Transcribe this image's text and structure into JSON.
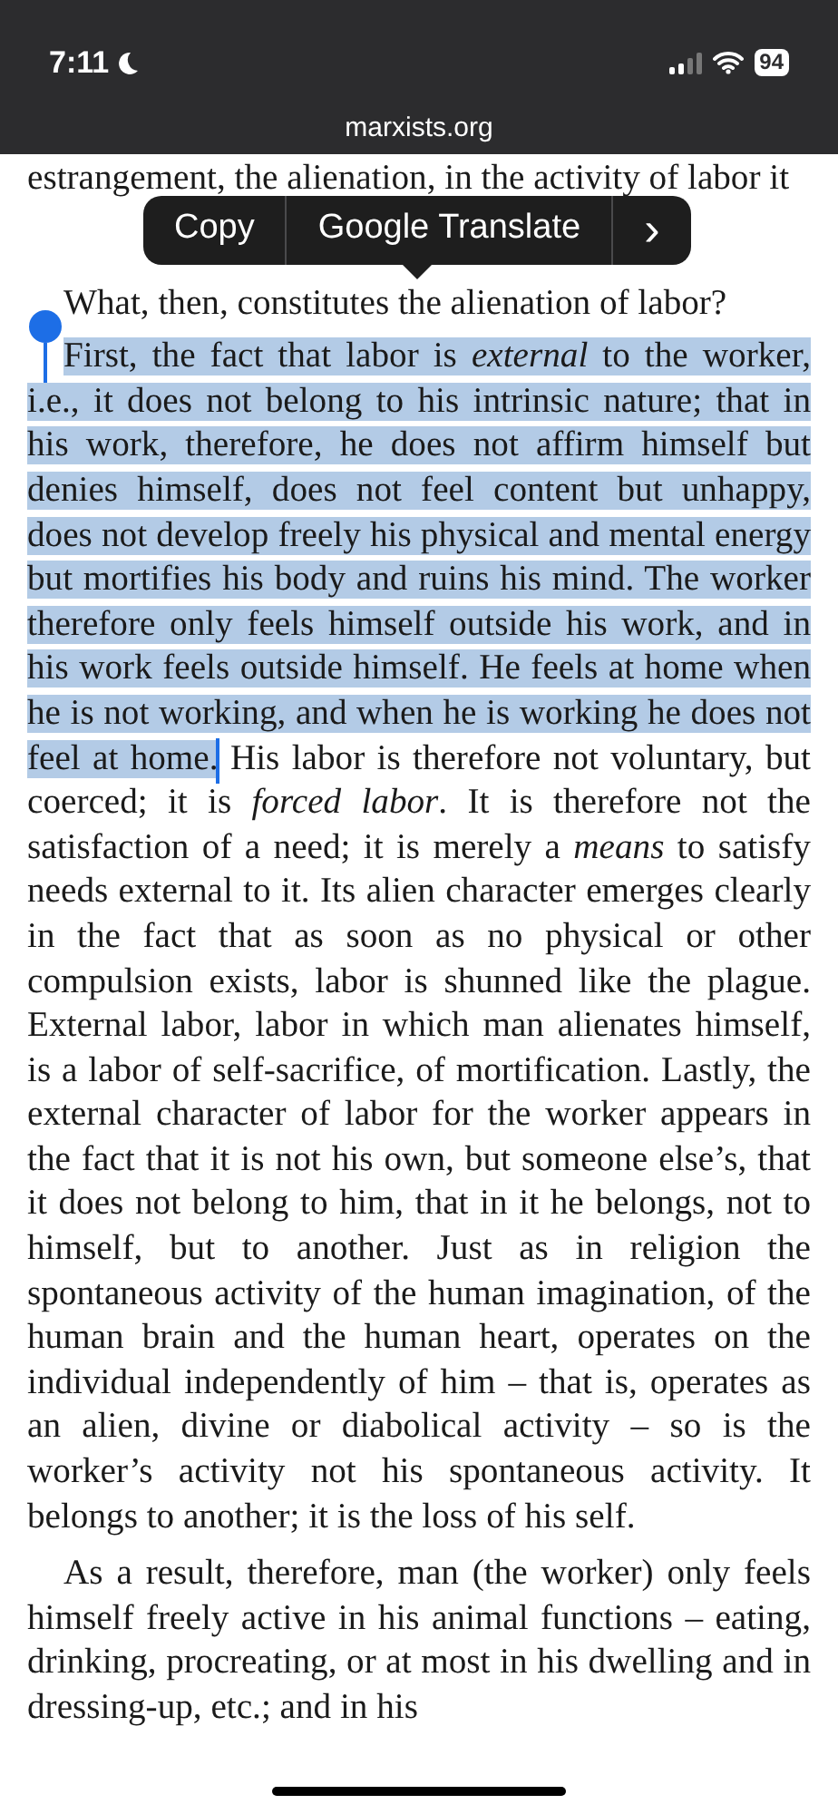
{
  "status_bar": {
    "time": "7:11",
    "battery": "94"
  },
  "address_bar": {
    "url": "marxists.org"
  },
  "edit_menu": {
    "items": [
      {
        "kind": "action",
        "label": "Copy"
      },
      {
        "kind": "action",
        "label": "Google Translate"
      },
      {
        "kind": "more",
        "label": "›"
      }
    ]
  },
  "paragraphs": [
    {
      "indent": false,
      "segments": [
        {
          "text": "estrangement, the alienation, in the activity of labor it",
          "selected": false
        }
      ]
    },
    {
      "indent": true,
      "segments": [
        {
          "text": "What, then, constitutes the alienation of labor?",
          "selected": false
        }
      ]
    },
    {
      "indent": true,
      "segments": [
        {
          "text": "First, the fact that labor is *external* to the worker, i.e., it does not belong to his intrinsic nature; that in his work, therefore, he does not affirm himself but denies himself, does not feel content but unhappy, does not develop freely his physical and mental energy but mortifies his body and ruins his mind. The worker therefore only feels himself outside his work, and in his work feels outside himself. He feels at home when he is not working, and when he is working he does not feel at home.",
          "selected": true
        },
        {
          "text": " His labor is therefore not voluntary, but coerced; it is *forced labor*. It is therefore not the satisfaction of a need; it is merely a *means* to satisfy needs external to it. Its alien character emerges clearly in the fact that as soon as no physical or other compulsion exists, labor is shunned like the plague. External labor, labor in which man alienates himself, is a labor of self-sacrifice, of mortification. Lastly, the external character of labor for the worker appears in the fact that it is not his own, but someone else’s, that it does not belong to him, that in it he belongs, not to himself, but to another. Just as in religion the spontaneous activity of the human imagination, of the human brain and the human heart, operates on the individual independently of him – that is, operates as an alien, divine or diabolical activity – so is the worker’s activity not his spontaneous activity. It belongs to another; it is the loss of his self.",
          "selected": false
        }
      ]
    },
    {
      "indent": true,
      "segments": [
        {
          "text": "As a result, therefore, man (the worker) only feels himself freely active in his animal functions – eating, drinking, procreating, or at most in his dwelling and in dressing-up, etc.; and in his",
          "selected": false
        }
      ]
    }
  ]
}
